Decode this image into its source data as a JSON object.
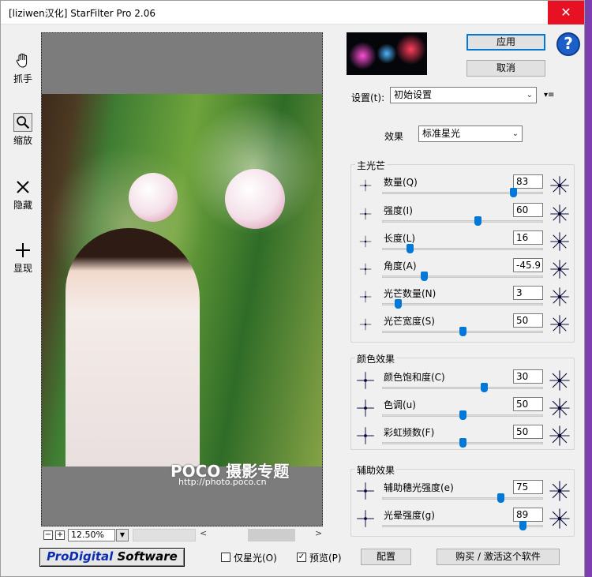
{
  "window": {
    "title": "[liziwen汉化] StarFilter Pro 2.06",
    "close_glyph": "✕"
  },
  "tools": [
    {
      "name": "hand",
      "label": "抓手"
    },
    {
      "name": "zoom",
      "label": "缩放"
    },
    {
      "name": "hide",
      "label": "隐藏"
    },
    {
      "name": "show",
      "label": "显现"
    }
  ],
  "preview": {
    "watermark": "POCO 摄影专题",
    "watermark_url": "http://photo.poco.cn",
    "zoom": "12.50%",
    "minus": "−",
    "plus": "+",
    "dropdown": "▼",
    "scroll_left": "<",
    "scroll_right": ">"
  },
  "buttons": {
    "ok": "应用",
    "cancel": "取消",
    "help": "?",
    "config": "配置",
    "buy": "购买 / 激活这个软件"
  },
  "settings": {
    "label": "设置(t):",
    "value": "初始设置",
    "menu_glyph": "▾≡",
    "effect_label": "效果",
    "effect_value": "标准星光",
    "arrow": "⌄"
  },
  "groups": {
    "main": "主光芒",
    "color": "颜色效果",
    "aux": "辅助效果"
  },
  "sliders": [
    {
      "label": "数量(Q)",
      "value": "83",
      "fraction": 0.83
    },
    {
      "label": "强度(I)",
      "value": "60",
      "fraction": 0.6
    },
    {
      "label": "长度(L)",
      "value": "16",
      "fraction": 0.16
    },
    {
      "label": "角度(A)",
      "value": "-45.9",
      "fraction": 0.25
    },
    {
      "label": "光芒数量(N)",
      "value": "3",
      "fraction": 0.08
    },
    {
      "label": "光芒宽度(S)",
      "value": "50",
      "fraction": 0.5
    },
    {
      "label": "颜色饱和度(C)",
      "value": "30",
      "fraction": 0.64
    },
    {
      "label": "色调(u)",
      "value": "50",
      "fraction": 0.5
    },
    {
      "label": "彩虹频数(F)",
      "value": "50",
      "fraction": 0.5
    },
    {
      "label": "辅助穗光强度(e)",
      "value": "75",
      "fraction": 0.75
    },
    {
      "label": "光晕强度(g)",
      "value": "89",
      "fraction": 0.89
    }
  ],
  "options": {
    "stars_only": {
      "label": "仅星光(O)",
      "checked": false,
      "mark": ""
    },
    "preview": {
      "label": "预览(P)",
      "checked": true,
      "mark": "✓"
    }
  },
  "logo": {
    "prefix": "ProDigital",
    "suffix": " Software"
  }
}
